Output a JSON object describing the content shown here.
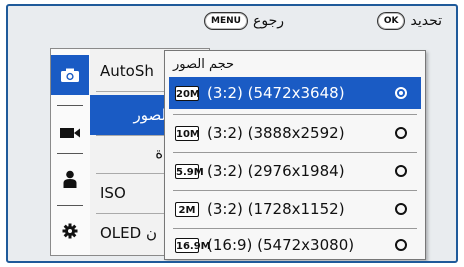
{
  "hints": {
    "confirm_key": "OK",
    "confirm_label": "تحديد",
    "back_key": "MENU",
    "back_label": "رجوع"
  },
  "tabs": [
    {
      "icon": "camera-icon"
    },
    {
      "icon": "video-camera-icon"
    },
    {
      "icon": "person-icon"
    },
    {
      "icon": "gear-icon"
    }
  ],
  "menu": {
    "items": [
      "AutoSh",
      "حجم الصور",
      "الجودة",
      "ISO",
      "OLED ن"
    ]
  },
  "popup": {
    "title": "حجم الصور",
    "options": [
      {
        "icon_text": "20M",
        "label": "(3:2) (5472x3648)",
        "selected": true
      },
      {
        "icon_text": "10M",
        "label": "(3:2) (3888x2592)",
        "selected": false
      },
      {
        "icon_text": "5.9M",
        "label": "(3:2) (2976x1984)",
        "selected": false
      },
      {
        "icon_text": "2M",
        "label": "(3:2) (1728x1152)",
        "selected": false
      },
      {
        "icon_text": "16.9M",
        "label": "(16:9) (5472x3080)",
        "selected": false
      }
    ]
  },
  "colors": {
    "accent": "#1a5bc4",
    "frame": "#1f5a9a",
    "background": "#e9ecef"
  }
}
